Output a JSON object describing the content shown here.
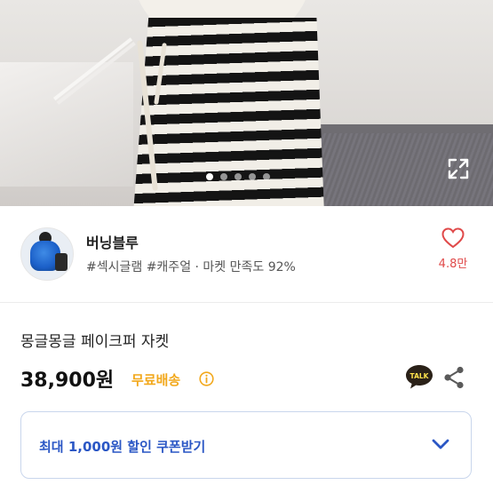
{
  "gallery": {
    "slide_count": 5,
    "active_index": 0
  },
  "seller": {
    "name": "버닝블루",
    "tags": "#섹시글램 #캐주얼 · 마켓 만족도 92%",
    "likes": "4.8만"
  },
  "product": {
    "title": "몽글몽글 페이크퍼 자켓",
    "price": "38,900원",
    "shipping": "무료배송"
  },
  "actions": {
    "talk_label": "TALK"
  },
  "coupon": {
    "label": "최대 1,000원 할인 쿠폰받기"
  },
  "colors": {
    "accent_blue": "#2b57c5",
    "heart_red": "#e04a4a",
    "shipping_orange": "#f2a81c"
  }
}
